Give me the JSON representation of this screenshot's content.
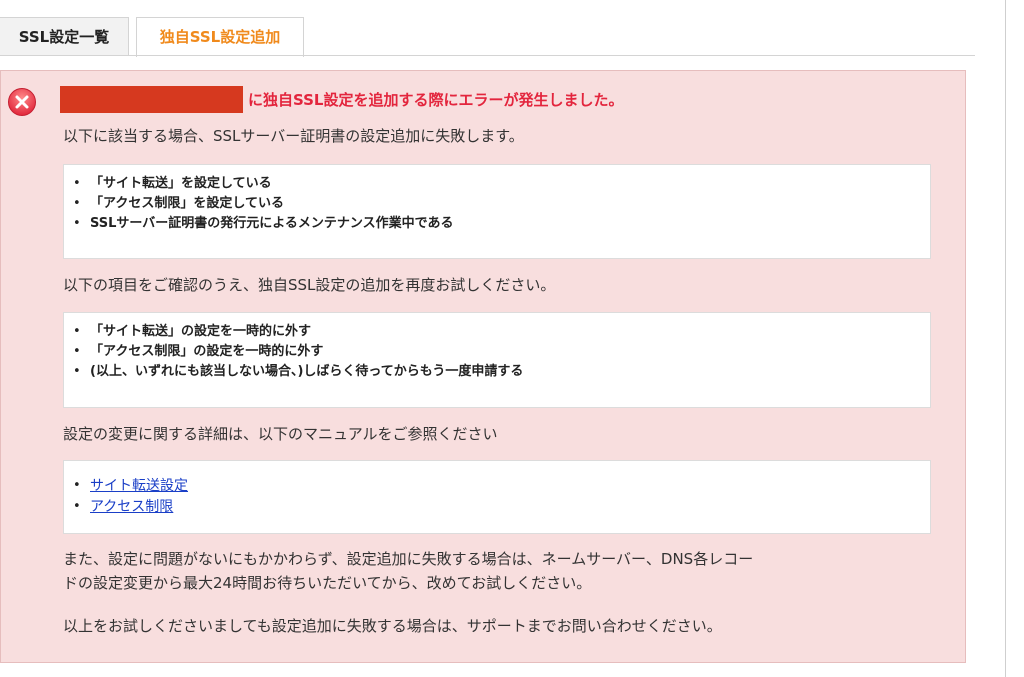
{
  "tabs": [
    {
      "label": "SSL設定一覧",
      "active": false
    },
    {
      "label": "独自SSL設定追加",
      "active": true
    }
  ],
  "error": {
    "title": "に独自SSL設定を追加する際にエラーが発生しました。",
    "intro": "以下に該当する場合、SSLサーバー証明書の設定追加に失敗します。",
    "causes": [
      "「サイト転送」を設定している",
      "「アクセス制限」を設定している",
      "SSLサーバー証明書の発行元によるメンテナンス作業中である"
    ],
    "check_intro": "以下の項目をご確認のうえ、独自SSL設定の追加を再度お試しください。",
    "checks": [
      "「サイト転送」の設定を一時的に外す",
      "「アクセス制限」の設定を一時的に外す",
      "(以上、いずれにも該当しない場合、)しばらく待ってからもう一度申請する"
    ],
    "manual_intro": "設定の変更に関する詳細は、以下のマニュアルをご参照ください",
    "manual_links": [
      "サイト転送設定",
      "アクセス制限"
    ],
    "note_line1": "また、設定に問題がないにもかかわらず、設定追加に失敗する場合は、ネームサーバー、DNS各レコー",
    "note_line2": "ドの設定変更から最大24時間お待ちいただいてから、改めてお試しください。",
    "support": "以上をお試しくださいましても設定追加に失敗する場合は、サポートまでお問い合わせください。"
  },
  "colors": {
    "panel_bg": "#f8dede",
    "error_red": "#e3253d",
    "active_tab_text": "#f08a1c",
    "link": "#1a3fc7",
    "redaction": "#d6391f"
  }
}
